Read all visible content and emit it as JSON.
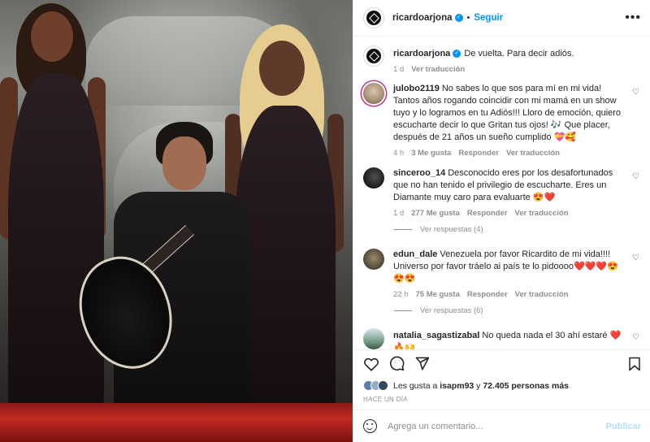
{
  "header": {
    "username": "ricardoarjona",
    "follow_label": "Seguir",
    "separator": "•",
    "more_icon": "more-horizontal-icon"
  },
  "caption": {
    "username": "ricardoarjona",
    "text": "De vuelta. Para decir adiós.",
    "time": "1 d",
    "translate_label": "Ver traducción"
  },
  "comments": [
    {
      "username": "julobo2119",
      "text": "No sabes lo que sos para mí en mi vida! Tantos años rogando coincidir con mi mamá en un show tuyo y lo logramos en tu Adiós!!! Lloro de emoción, quiero escucharte decir lo que Gritan tus ojos! 🎶 Que placer, después de 21 años un sueño cumplido 💝🥰",
      "time": "4 h",
      "likes": "3 Me gusta",
      "reply_label": "Responder",
      "translate_label": "Ver traducción"
    },
    {
      "username": "sinceroo_14",
      "text": "Desconocido eres por los desafortunados que no han tenido el privilegio de escucharte. Eres un Diamante muy caro para evaluarte 😍❤️",
      "time": "1 d",
      "likes": "277 Me gusta",
      "reply_label": "Responder",
      "translate_label": "Ver traducción",
      "replies_label": "Ver respuestas (4)"
    },
    {
      "username": "edun_dale",
      "text": "Venezuela por favor Ricardito de mi vida!!!! Universo por favor tráelo ai país te lo pidoooo❤️❤️❤️😍😍😍",
      "time": "22 h",
      "likes": "75 Me gusta",
      "reply_label": "Responder",
      "translate_label": "Ver traducción",
      "replies_label": "Ver respuestas (6)"
    },
    {
      "username": "natalia_sagastizabal",
      "text": "No queda nada el 30 ahí estaré ❤️🔥🙌"
    }
  ],
  "likes": {
    "prefix": "Les gusta a",
    "user": "isapm93",
    "connector": "y",
    "others": "72.405 personas más"
  },
  "post_time": "HACE UN DÍA",
  "add_comment": {
    "placeholder": "Agrega un comentario...",
    "publish_label": "Publicar"
  },
  "colors": {
    "accent": "#0095f6",
    "muted": "#8e8e8e",
    "publish_disabled": "#b2dffc"
  }
}
